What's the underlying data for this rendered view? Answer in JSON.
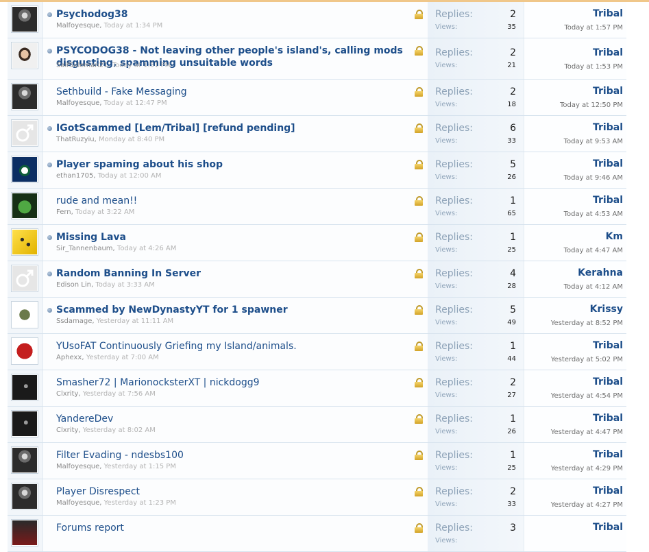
{
  "labels": {
    "replies": "Replies:",
    "views": "Views:"
  },
  "threads": [
    {
      "title": "Psychodog38",
      "author": "Malfoyesque",
      "date": "Today at 1:34 PM",
      "replies": "2",
      "views": "35",
      "last_user": "Tribal",
      "last_date": "Today at 1:57 PM",
      "avatar": "portrait-dark-icon"
    },
    {
      "title": "PSYCODOG38 - Not leaving other people's island's, calling mods disgusting, spamming unsuitable words",
      "author": "SaifSuleman21",
      "date": "Today at 1:51 PM",
      "replies": "2",
      "views": "21",
      "last_user": "Tribal",
      "last_date": "Today at 1:53 PM",
      "avatar": "portrait-man-icon"
    },
    {
      "title": "Sethbuild - Fake Messaging",
      "author": "Malfoyesque",
      "date": "Today at 12:47 PM",
      "replies": "2",
      "views": "18",
      "last_user": "Tribal",
      "last_date": "Today at 12:50 PM",
      "avatar": "portrait-dark-icon"
    },
    {
      "title": "IGotScammed [Lem/Tribal] [refund pending]",
      "author": "ThatRuzyiu",
      "date": "Monday at 8:40 PM",
      "replies": "6",
      "views": "33",
      "last_user": "Tribal",
      "last_date": "Today at 9:53 AM",
      "avatar": "default-male-icon"
    },
    {
      "title": "Player spaming about his shop",
      "author": "ethan1705",
      "date": "Today at 12:00 AM",
      "replies": "5",
      "views": "26",
      "last_user": "Tribal",
      "last_date": "Today at 9:46 AM",
      "avatar": "vancouver-logo-icon"
    },
    {
      "title": "rude and mean!!",
      "author": "Fern",
      "date": "Today at 3:22 AM",
      "replies": "1",
      "views": "65",
      "last_user": "Tribal",
      "last_date": "Today at 4:53 AM",
      "avatar": "frog-icon"
    },
    {
      "title": "Missing Lava",
      "author": "Sir_Tannenbaum",
      "date": "Today at 4:26 AM",
      "replies": "1",
      "views": "25",
      "last_user": "Km",
      "last_date": "Today at 4:47 AM",
      "avatar": "yellow-block-icon"
    },
    {
      "title": "Random Banning In Server",
      "author": "Edison Lin",
      "date": "Today at 3:33 AM",
      "replies": "4",
      "views": "28",
      "last_user": "Kerahna",
      "last_date": "Today at 4:12 AM",
      "avatar": "default-male-icon"
    },
    {
      "title": "Scammed by NewDynastyYT for 1 spawner",
      "author": "Ssdamage",
      "date": "Yesterday at 11:11 AM",
      "replies": "5",
      "views": "49",
      "last_user": "Krissy",
      "last_date": "Yesterday at 8:52 PM",
      "avatar": "robot-icon"
    },
    {
      "title": "YUsoFAT Continuously Griefing my Island/animals.",
      "author": "Aphexx",
      "date": "Yesterday at 7:00 AM",
      "replies": "1",
      "views": "44",
      "last_user": "Tribal",
      "last_date": "Yesterday at 5:02 PM",
      "avatar": "w-logo-icon"
    },
    {
      "title": "Smasher72 | MarionocksterXT | nickdogg9",
      "author": "Clxrity",
      "date": "Yesterday at 7:56 AM",
      "replies": "2",
      "views": "27",
      "last_user": "Tribal",
      "last_date": "Yesterday at 4:54 PM",
      "avatar": "dark-face-icon"
    },
    {
      "title": "YandereDev",
      "author": "Clxrity",
      "date": "Yesterday at 8:02 AM",
      "replies": "1",
      "views": "26",
      "last_user": "Tribal",
      "last_date": "Yesterday at 4:47 PM",
      "avatar": "dark-face-icon"
    },
    {
      "title": "Filter Evading - ndesbs100",
      "author": "Malfoyesque",
      "date": "Yesterday at 1:15 PM",
      "replies": "1",
      "views": "25",
      "last_user": "Tribal",
      "last_date": "Yesterday at 4:29 PM",
      "avatar": "portrait-dark-icon"
    },
    {
      "title": "Player Disrespect",
      "author": "Malfoyesque",
      "date": "Yesterday at 1:23 PM",
      "replies": "2",
      "views": "33",
      "last_user": "Tribal",
      "last_date": "Yesterday at 4:27 PM",
      "avatar": "portrait-dark-icon"
    },
    {
      "title": "Forums report",
      "author": "",
      "date": "",
      "replies": "3",
      "views": "",
      "last_user": "Tribal",
      "last_date": "",
      "avatar": "portrait-red-icon"
    }
  ],
  "bold_rows": [
    0,
    1,
    3,
    4,
    6,
    7,
    8
  ]
}
